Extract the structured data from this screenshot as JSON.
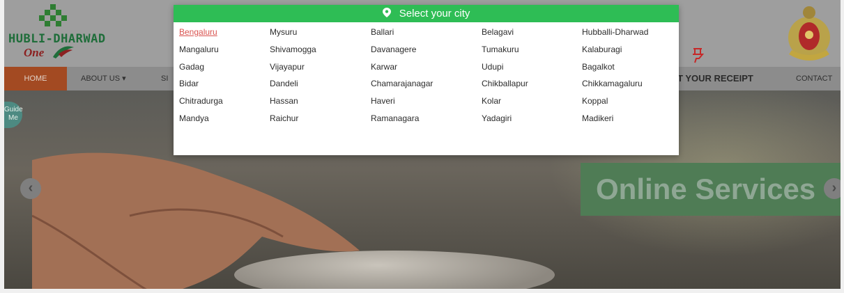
{
  "header": {
    "logo_text": "HUBLI-DHARWAD",
    "logo_one": "One"
  },
  "nav": {
    "home": "HOME",
    "about": "ABOUT US ▾",
    "si": "SI",
    "receipt": "T YOUR RECEIPT",
    "contact": "CONTACT US"
  },
  "hero": {
    "guide_me": "Guide Me",
    "online_services": "Online Services",
    "prev": "‹",
    "next": "›"
  },
  "modal": {
    "title": "Select your city",
    "cities": [
      [
        "Bengaluru",
        "Mysuru",
        "Ballari",
        "Belagavi",
        "Hubballi-Dharwad"
      ],
      [
        "Mangaluru",
        "Shivamogga",
        "Davanagere",
        "Tumakuru",
        "Kalaburagi"
      ],
      [
        "Gadag",
        "Vijayapur",
        "Karwar",
        "Udupi",
        "Bagalkot"
      ],
      [
        "Bidar",
        "Dandeli",
        "Chamarajanagar",
        "Chikballapur",
        "Chikkamagaluru"
      ],
      [
        "Chitradurga",
        "Hassan",
        "Haveri",
        "Kolar",
        "Koppal"
      ],
      [
        "Mandya",
        "Raichur",
        "Ramanagara",
        "Yadagiri",
        "Madikeri"
      ]
    ],
    "active_city": "Bengaluru"
  },
  "colors": {
    "modal_header": "#2ebd55",
    "active_city": "#d9534f",
    "nav_home": "#a34a22",
    "online_services_bg": "#4f7c55"
  },
  "icons": [
    "location-pin-icon",
    "receipt-hand-icon",
    "chevron-left-icon",
    "chevron-right-icon",
    "state-emblem"
  ]
}
